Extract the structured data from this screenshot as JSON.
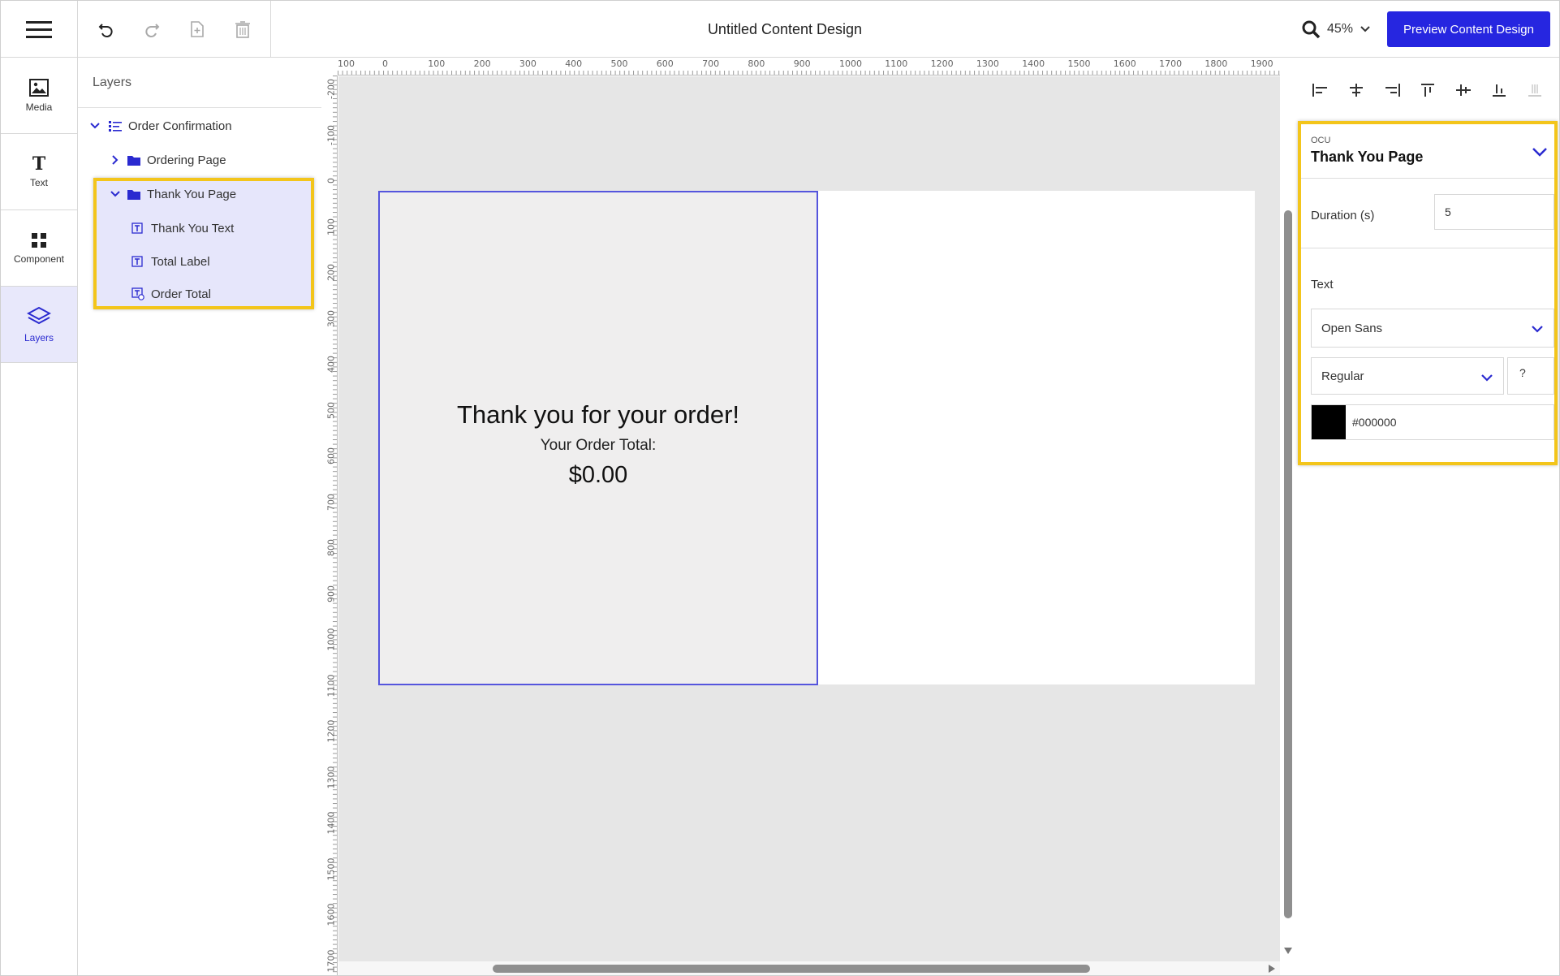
{
  "app": {
    "document_title": "Untitled Content Design",
    "zoom": "45%",
    "preview_label": "Preview Content Design"
  },
  "rail": {
    "items": [
      {
        "label": "Media",
        "icon": "image-icon"
      },
      {
        "label": "Text",
        "icon": "text-icon"
      },
      {
        "label": "Component",
        "icon": "component-grid-icon"
      },
      {
        "label": "Layers",
        "icon": "layers-icon"
      }
    ]
  },
  "layers": {
    "title": "Layers",
    "tree": [
      {
        "label": "Order Confirmation",
        "level": 0,
        "expanded": true
      },
      {
        "label": "Ordering Page",
        "level": 1,
        "expanded": false
      },
      {
        "label": "Thank You Page",
        "level": 1,
        "expanded": true
      },
      {
        "label": "Thank You Text",
        "level": 2
      },
      {
        "label": "Total Label",
        "level": 2
      },
      {
        "label": "Order Total",
        "level": 2
      }
    ]
  },
  "rulers": {
    "top": [
      "100",
      "0",
      "100",
      "200",
      "300",
      "400",
      "500",
      "600",
      "700",
      "800",
      "900",
      "1000",
      "1100",
      "1200",
      "1300",
      "1400",
      "1500",
      "1600",
      "1700",
      "1800",
      "1900"
    ],
    "left": [
      "-200",
      "-100",
      "0",
      "100",
      "200",
      "300",
      "400",
      "500",
      "600",
      "700",
      "800",
      "900",
      "1000",
      "1100",
      "1200",
      "1300",
      "1400",
      "1500",
      "1600",
      "1700"
    ]
  },
  "canvas": {
    "heading": "Thank you for your order!",
    "total_label": "Your Order Total:",
    "total_value": "$0.00"
  },
  "props": {
    "type_label": "OCU",
    "name": "Thank You Page",
    "duration_label": "Duration (s)",
    "duration_value": "5",
    "text_section": "Text",
    "font_family": "Open Sans",
    "font_weight": "Regular",
    "font_size": "?",
    "color_hex": "#000000"
  },
  "colors": {
    "accent": "#2626e0",
    "highlight": "#f3c51b",
    "selection_bg": "#e6e6fb"
  }
}
